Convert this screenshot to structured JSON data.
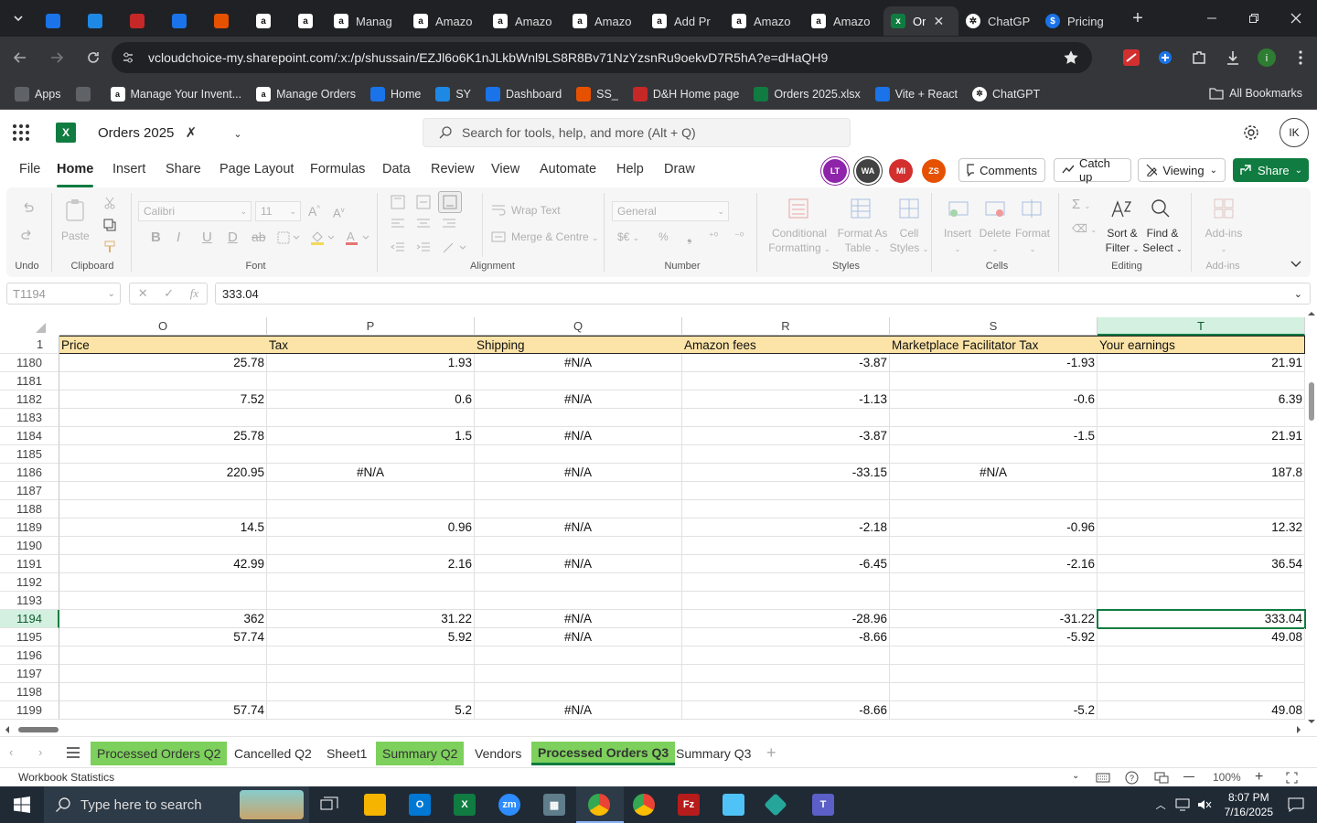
{
  "browser": {
    "tabs": [
      {
        "label": "",
        "icon": "chevron-down-icon"
      },
      {
        "label": "",
        "icon": "app-icon",
        "color": "#1a73e8"
      },
      {
        "label": "",
        "icon": "ec-icon",
        "color": "#1e88e5"
      },
      {
        "label": "",
        "icon": "dh-icon",
        "color": "#c62828"
      },
      {
        "label": "",
        "icon": "g-icon",
        "color": "#1a73e8"
      },
      {
        "label": "",
        "icon": "ss-icon",
        "color": "#e65100"
      },
      {
        "label": "",
        "icon": "amazon-icon"
      },
      {
        "label": "",
        "icon": "amazon-icon"
      },
      {
        "label": "Manag",
        "icon": "amazon-icon"
      },
      {
        "label": "Amazo",
        "icon": "amazon-icon"
      },
      {
        "label": "Amazo",
        "icon": "amazon-icon"
      },
      {
        "label": "Amazo",
        "icon": "amazon-icon"
      },
      {
        "label": "Add Pr",
        "icon": "amazon-icon"
      },
      {
        "label": "Amazo",
        "icon": "amazon-icon"
      },
      {
        "label": "Amazo",
        "icon": "amazon-icon"
      },
      {
        "label": "Or",
        "icon": "excel-icon",
        "active": true
      },
      {
        "label": "ChatGP",
        "icon": "chatgpt-icon"
      },
      {
        "label": "Pricing",
        "icon": "dollar-icon"
      }
    ],
    "url": "vcloudchoice-my.sharepoint.com/:x:/p/shussain/EZJl6o6K1nJLkbWnl9LS8R8Bv71NzYzsnRu9oekvD7R5hA?e=dHaQH9",
    "bookmarks": [
      {
        "label": "Apps",
        "icon": "grid-icon"
      },
      {
        "label": "",
        "icon": "apps-grid-icon"
      },
      {
        "label": "Manage Your Invent...",
        "icon": "amazon-icon"
      },
      {
        "label": "Manage Orders",
        "icon": "amazon-icon"
      },
      {
        "label": "Home",
        "icon": "g-icon"
      },
      {
        "label": "SY",
        "icon": "ec-icon"
      },
      {
        "label": "Dashboard",
        "icon": "app-icon"
      },
      {
        "label": "SS_",
        "icon": "ss-icon"
      },
      {
        "label": "D&H Home page",
        "icon": "dh-icon"
      },
      {
        "label": "Orders 2025.xlsx",
        "icon": "excel-icon"
      },
      {
        "label": "Vite + React",
        "icon": "dollar-icon"
      },
      {
        "label": "ChatGPT",
        "icon": "chatgpt-icon"
      }
    ],
    "all_bookmarks": "All Bookmarks"
  },
  "excel": {
    "doc_title": "Orders 2025",
    "search_placeholder": "Search for tools, help, and more (Alt + Q)",
    "user_initials": "IK",
    "menu": [
      "File",
      "Home",
      "Insert",
      "Share",
      "Page Layout",
      "Formulas",
      "Data",
      "Review",
      "View",
      "Automate",
      "Help",
      "Draw"
    ],
    "active_menu": "Home",
    "collaborators": [
      {
        "initials": "LT",
        "color": "#8e24aa"
      },
      {
        "initials": "WA",
        "color": "#424242"
      },
      {
        "initials": "MI",
        "color": "#d32f2f"
      },
      {
        "initials": "ZS",
        "color": "#e65100"
      }
    ],
    "comments_label": "Comments",
    "catchup_label": "Catch up",
    "viewing_label": "Viewing",
    "share_label": "Share",
    "ribbon": {
      "undo_group": "Undo",
      "clipboard_group": "Clipboard",
      "paste_label": "Paste",
      "font_group": "Font",
      "font_name": "Calibri",
      "font_size": "11",
      "alignment_group": "Alignment",
      "wrap_text": "Wrap Text",
      "merge_centre": "Merge & Centre",
      "number_group": "Number",
      "number_format": "General",
      "styles_group": "Styles",
      "conditional_formatting_1": "Conditional",
      "conditional_formatting_2": "Formatting",
      "format_as_table_1": "Format As",
      "format_as_table_2": "Table",
      "cell_styles_1": "Cell",
      "cell_styles_2": "Styles",
      "cells_group": "Cells",
      "insert": "Insert",
      "delete": "Delete",
      "format": "Format",
      "editing_group": "Editing",
      "sort_filter_1": "Sort &",
      "sort_filter_2": "Filter",
      "find_select_1": "Find &",
      "find_select_2": "Select",
      "addins_group": "Add-ins",
      "addins": "Add-ins"
    },
    "name_box": "T1194",
    "formula_value": "333.04",
    "columns": [
      {
        "letter": "O",
        "header": "Price"
      },
      {
        "letter": "P",
        "header": "Tax"
      },
      {
        "letter": "Q",
        "header": "Shipping"
      },
      {
        "letter": "R",
        "header": "Amazon fees"
      },
      {
        "letter": "S",
        "header": "Marketplace Facilitator Tax"
      },
      {
        "letter": "T",
        "header": "Your earnings"
      }
    ],
    "selected_column": "T",
    "header_row_number": "1",
    "rows": [
      {
        "n": "1180",
        "cells": [
          "25.78",
          "1.93",
          "#N/A",
          "-3.87",
          "-1.93",
          "21.91"
        ]
      },
      {
        "n": "1181",
        "cells": [
          "",
          "",
          "",
          "",
          "",
          ""
        ]
      },
      {
        "n": "1182",
        "cells": [
          "7.52",
          "0.6",
          "#N/A",
          "-1.13",
          "-0.6",
          "6.39"
        ]
      },
      {
        "n": "1183",
        "cells": [
          "",
          "",
          "",
          "",
          "",
          ""
        ]
      },
      {
        "n": "1184",
        "cells": [
          "25.78",
          "1.5",
          "#N/A",
          "-3.87",
          "-1.5",
          "21.91"
        ]
      },
      {
        "n": "1185",
        "cells": [
          "",
          "",
          "",
          "",
          "",
          ""
        ]
      },
      {
        "n": "1186",
        "cells": [
          "220.95",
          "#N/A",
          "#N/A",
          "-33.15",
          "#N/A",
          "187.8"
        ]
      },
      {
        "n": "1187",
        "cells": [
          "",
          "",
          "",
          "",
          "",
          ""
        ]
      },
      {
        "n": "1188",
        "cells": [
          "",
          "",
          "",
          "",
          "",
          ""
        ]
      },
      {
        "n": "1189",
        "cells": [
          "14.5",
          "0.96",
          "#N/A",
          "-2.18",
          "-0.96",
          "12.32"
        ]
      },
      {
        "n": "1190",
        "cells": [
          "",
          "",
          "",
          "",
          "",
          ""
        ]
      },
      {
        "n": "1191",
        "cells": [
          "42.99",
          "2.16",
          "#N/A",
          "-6.45",
          "-2.16",
          "36.54"
        ]
      },
      {
        "n": "1192",
        "cells": [
          "",
          "",
          "",
          "",
          "",
          ""
        ]
      },
      {
        "n": "1193",
        "cells": [
          "",
          "",
          "",
          "",
          "",
          ""
        ]
      },
      {
        "n": "1194",
        "cells": [
          "362",
          "31.22",
          "#N/A",
          "-28.96",
          "-31.22",
          "333.04"
        ],
        "selected": true
      },
      {
        "n": "1195",
        "cells": [
          "57.74",
          "5.92",
          "#N/A",
          "-8.66",
          "-5.92",
          "49.08"
        ]
      },
      {
        "n": "1196",
        "cells": [
          "",
          "",
          "",
          "",
          "",
          ""
        ]
      },
      {
        "n": "1197",
        "cells": [
          "",
          "",
          "",
          "",
          "",
          ""
        ]
      },
      {
        "n": "1198",
        "cells": [
          "",
          "",
          "",
          "",
          "",
          ""
        ]
      },
      {
        "n": "1199",
        "cells": [
          "57.74",
          "5.2",
          "#N/A",
          "-8.66",
          "-5.2",
          "49.08"
        ]
      }
    ],
    "sheets": [
      {
        "label": "Processed Orders Q2",
        "style": "green"
      },
      {
        "label": "Cancelled Q2",
        "style": ""
      },
      {
        "label": "Sheet1",
        "style": ""
      },
      {
        "label": "Summary Q2",
        "style": "green"
      },
      {
        "label": "Vendors",
        "style": ""
      },
      {
        "label": "Processed Orders Q3",
        "style": "greenactive"
      },
      {
        "label": "Summary Q3",
        "style": ""
      }
    ],
    "status_left": "Workbook Statistics",
    "zoom": "100%"
  },
  "taskbar": {
    "search_placeholder": "Type here to search",
    "time": "8:07 PM",
    "date": "7/16/2025"
  },
  "colors": {
    "excel_green": "#107c41",
    "header_fill": "#fce4a8",
    "sheet_green": "#7dd05c"
  }
}
